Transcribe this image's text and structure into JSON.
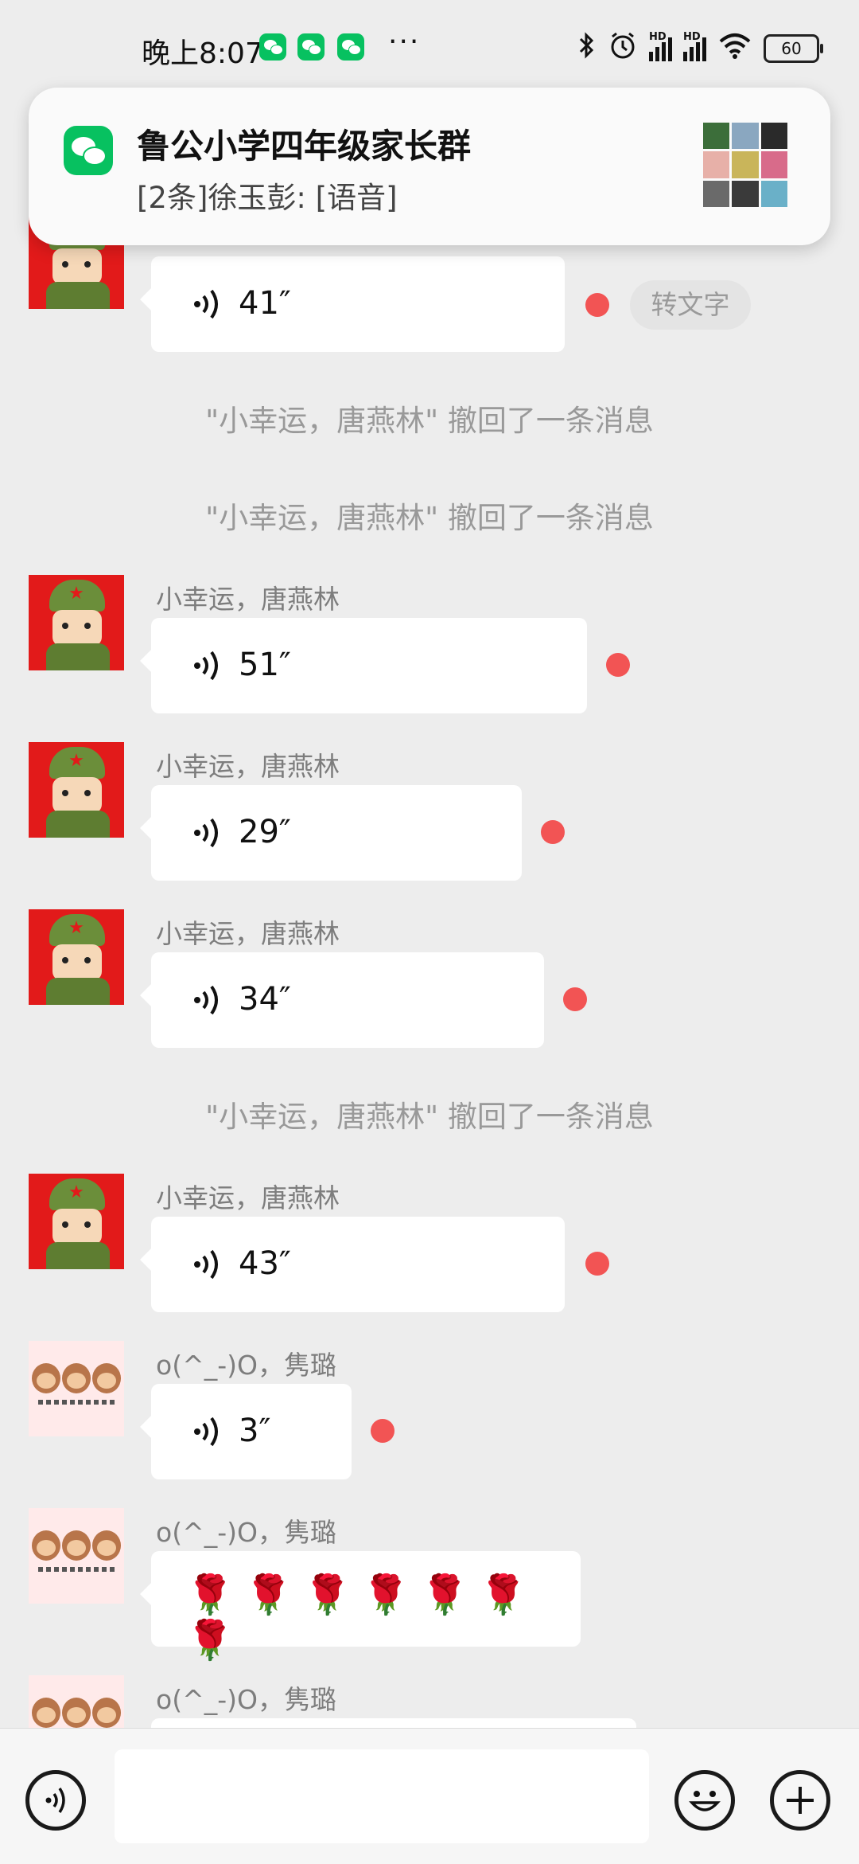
{
  "status_bar": {
    "time": "晚上8:07",
    "more": "···",
    "hd": "HD",
    "battery": "60"
  },
  "notification": {
    "title": "鲁公小学四年级家长群",
    "subtitle": "[2条]徐玉彭: [语音]"
  },
  "chat": {
    "convert_label": "转文字",
    "recall_notices": [
      "\"小幸运，唐燕林\" 撤回了一条消息",
      "\"小幸运，唐燕林\" 撤回了一条消息",
      "\"小幸运，唐燕林\" 撤回了一条消息"
    ],
    "messages": [
      {
        "sender": "",
        "duration": "41″"
      },
      {
        "sender": "小幸运，唐燕林",
        "duration": "51″"
      },
      {
        "sender": "小幸运，唐燕林",
        "duration": "29″"
      },
      {
        "sender": "小幸运，唐燕林",
        "duration": "34″"
      },
      {
        "sender": "小幸运，唐燕林",
        "duration": "43″"
      },
      {
        "sender": "o(^_-)O，隽璐",
        "duration": "3″"
      },
      {
        "sender": "o(^_-)O，隽璐",
        "content": "🌹🌹🌹🌹🌹🌹🌹"
      },
      {
        "sender": "o(^_-)O，隽璐",
        "content": ""
      }
    ]
  },
  "input_bar": {
    "placeholder": ""
  },
  "colors": {
    "background": "#ededed",
    "bubble": "#ffffff",
    "unread_dot": "#f25454",
    "wechat_green": "#07c160"
  }
}
